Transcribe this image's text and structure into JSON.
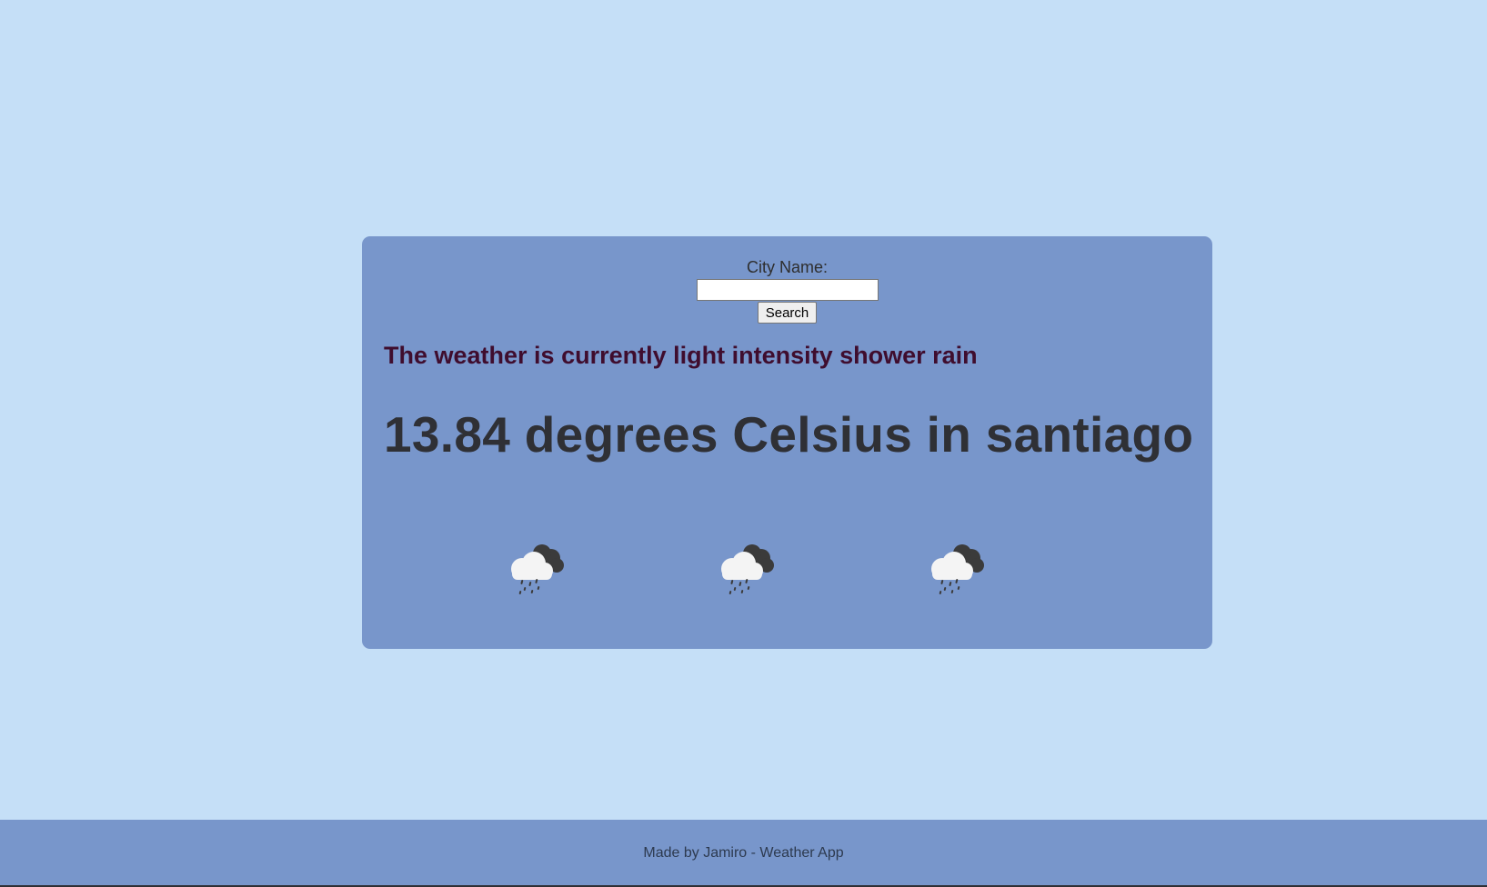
{
  "form": {
    "label": "City Name:",
    "input_value": "",
    "input_placeholder": "",
    "button_label": "Search"
  },
  "weather": {
    "description": "The weather is currently light intensity shower rain",
    "temperature_line": "13.84 degrees Celsius in santiago"
  },
  "icons": [
    {
      "name": "rain-cloud-icon"
    },
    {
      "name": "rain-cloud-icon"
    },
    {
      "name": "rain-cloud-icon"
    }
  ],
  "footer": {
    "text": "Made by Jamiro - Weather App"
  },
  "colors": {
    "page_background": "#c5dff7",
    "card_background": "#7896cb",
    "description_color": "#3f0d2e",
    "temperature_color": "#2f3035"
  }
}
